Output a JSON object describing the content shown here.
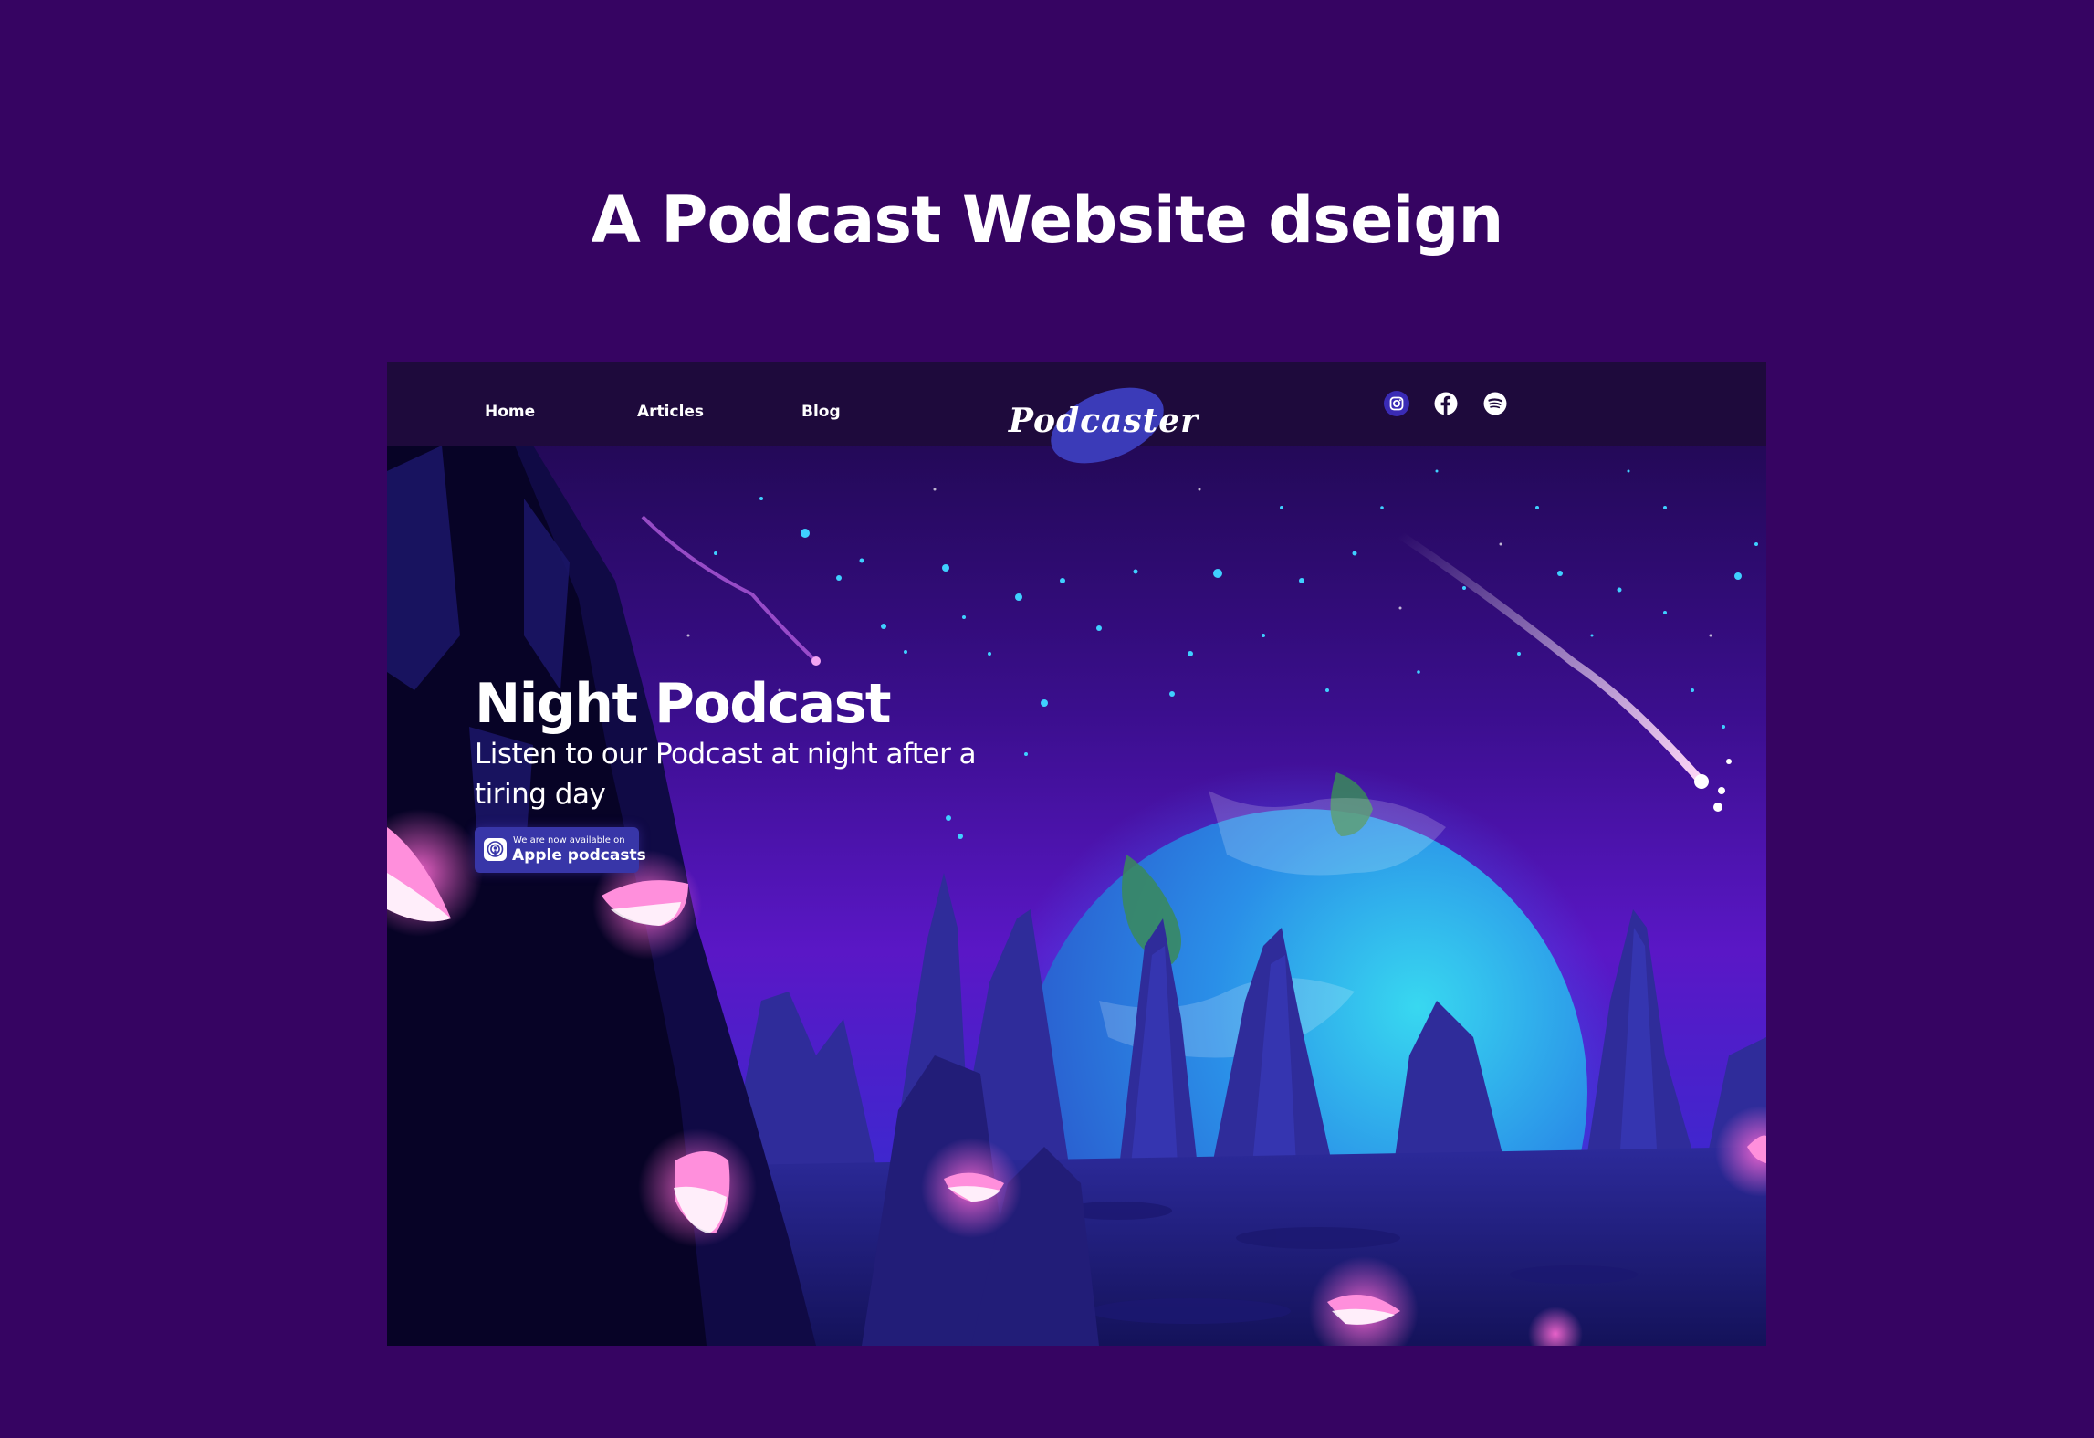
{
  "showcase": {
    "title": "A Podcast Website dseign"
  },
  "nav": {
    "items": [
      {
        "label": "Home"
      },
      {
        "label": "Articles"
      },
      {
        "label": "Blog"
      }
    ]
  },
  "logo": {
    "text": "Podcaster"
  },
  "social": {
    "icons": [
      "instagram-icon",
      "facebook-icon",
      "spotify-icon"
    ]
  },
  "hero": {
    "title": "Night Podcast",
    "subtitle": "Listen to our Podcast at night after a tiring day",
    "badge": {
      "small_text": "We are now available on",
      "big_text": "Apple podcasts",
      "icon": "apple-podcasts-icon"
    }
  },
  "colors": {
    "page_background": "#360462",
    "navbar": "#1e0a3c",
    "logo_blob": "#3b3bb8",
    "badge": "#3836a8",
    "planet": "#2aa6ff",
    "glow_pink": "#ff5ac8"
  }
}
